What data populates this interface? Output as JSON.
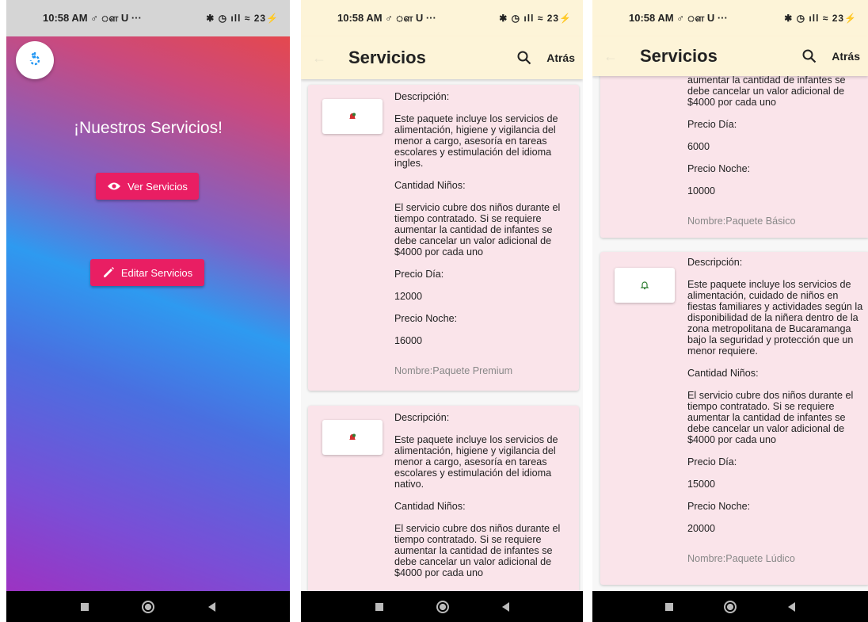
{
  "status_bar": {
    "time": "10:58 AM",
    "app_icons": "♂ ௗ U ···",
    "battery": "23"
  },
  "screen1": {
    "title": "¡Nuestros Servicios!",
    "ver_label": "Ver Servicios",
    "editar_label": "Editar Servicios"
  },
  "appbar": {
    "title": "Servicios",
    "back_label": "Atrás"
  },
  "screen2": {
    "card1": {
      "desc_label": "Descripción:",
      "desc": "Este paquete incluye los servicios de alimentación, higiene y vigilancia del menor a cargo, asesoría en tareas escolares y estimulación del idioma ingles.",
      "cant_label": "Cantidad Niños:",
      "cant": "El servicio cubre dos niños durante el tiempo contratado. Si se requiere aumentar la cantidad de infantes se debe cancelar un valor  adicional de $4000 por cada uno",
      "dia_label": "Precio Día:",
      "dia": "12000",
      "noche_label": "Precio Noche:",
      "noche": "16000",
      "nombre": "Nombre:Paquete Premium"
    },
    "card2": {
      "desc_label": "Descripción:",
      "desc": "Este paquete incluye los servicios de alimentación, higiene y vigilancia del menor a cargo, asesoría en tareas escolares y estimulación del idioma nativo.",
      "cant_label": "Cantidad Niños:",
      "cant": "El servicio cubre dos niños durante el tiempo contratado. Si se requiere aumentar la cantidad de infantes se debe cancelar un valor  adicional de $4000 por cada uno"
    }
  },
  "screen3": {
    "card1": {
      "cant_tail": "aumentar la cantidad de infantes se debe cancelar un valor  adicional de $4000 por cada uno",
      "dia_label": "Precio Día:",
      "dia": "6000",
      "noche_label": "Precio Noche:",
      "noche": "10000",
      "nombre": "Nombre:Paquete Básico"
    },
    "card2": {
      "desc_label": "Descripción:",
      "desc": "Este paquete incluye los servicios de alimentación, cuidado de niños en fiestas familiares y actividades según la disponibilidad de la niñera dentro de la zona metropolitana de Bucaramanga bajo la seguridad y protección que un menor requiere.",
      "cant_label": "Cantidad Niños:",
      "cant": "El servicio cubre dos niños durante el tiempo contratado. Si se requiere aumentar la cantidad de infantes se debe cancelar un valor  adicional de $4000 por cada uno",
      "dia_label": "Precio Día:",
      "dia": "15000",
      "noche_label": "Precio Noche:",
      "noche": "20000",
      "nombre": "Nombre:Paquete Lúdico"
    }
  },
  "colors": {
    "accent": "#e91e63",
    "appbar": "#fdf4d8",
    "card": "#fae4ea"
  },
  "icons": [
    "refresh-icon",
    "eye-icon",
    "pencil-icon",
    "search-icon",
    "bell-icon",
    "nav-square-icon",
    "nav-circle-icon",
    "nav-triangle-icon"
  ]
}
